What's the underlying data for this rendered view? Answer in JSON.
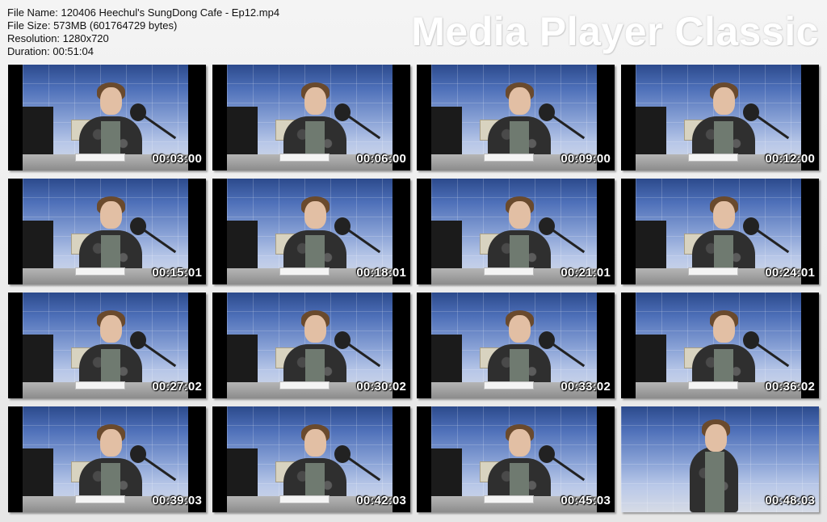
{
  "file_info": {
    "file_name": "File Name: 120406 Heechul's SungDong Cafe - Ep12.mp4",
    "file_size": "File Size: 573MB (601764729 bytes)",
    "resolution": "Resolution: 1280x720",
    "duration": "Duration: 00:51:04"
  },
  "brand": "Media Player Classic",
  "thumbnails": [
    {
      "time": "00:03:00"
    },
    {
      "time": "00:06:00"
    },
    {
      "time": "00:09:00"
    },
    {
      "time": "00:12:00"
    },
    {
      "time": "00:15:01"
    },
    {
      "time": "00:18:01"
    },
    {
      "time": "00:21:01"
    },
    {
      "time": "00:24:01"
    },
    {
      "time": "00:27:02"
    },
    {
      "time": "00:30:02"
    },
    {
      "time": "00:33:02"
    },
    {
      "time": "00:36:02"
    },
    {
      "time": "00:39:03"
    },
    {
      "time": "00:42:03"
    },
    {
      "time": "00:45:03"
    },
    {
      "time": "00:48:03"
    }
  ]
}
